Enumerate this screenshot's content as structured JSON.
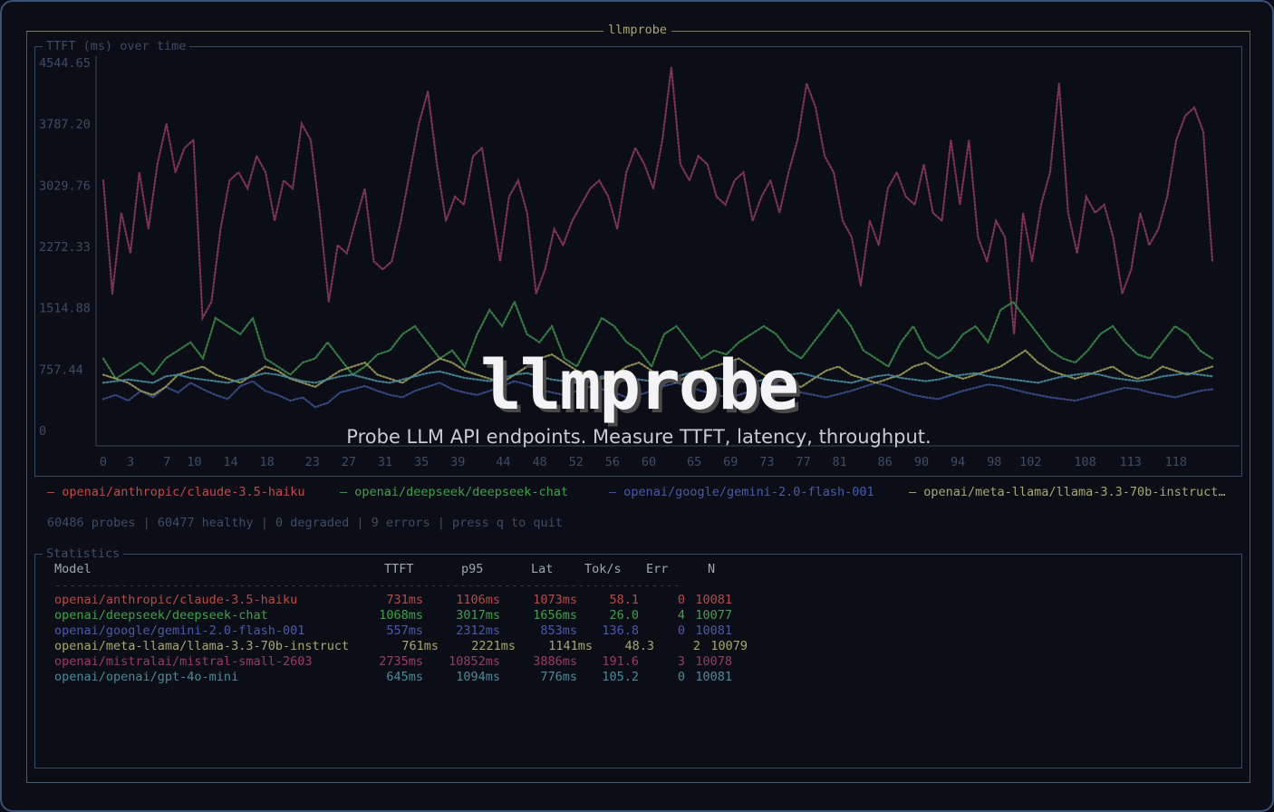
{
  "app": {
    "window_title": "llmprobe",
    "overlay_title": "llmprobe",
    "overlay_subtitle": "Probe LLM API endpoints. Measure TTFT, latency, throughput."
  },
  "chart_panel": {
    "title": "TTFT (ms) over time"
  },
  "chart_data": {
    "type": "line",
    "title": "TTFT (ms) over time",
    "xlabel": "",
    "ylabel": "",
    "ylim": [
      0,
      4544.65
    ],
    "xlim": [
      0,
      122
    ],
    "y_ticks": [
      "4544.65",
      "3787.20",
      "3029.76",
      "2272.33",
      "1514.88",
      "757.44",
      "0"
    ],
    "x_ticks": [
      "0",
      "3",
      "7",
      "10",
      "14",
      "18",
      "23",
      "27",
      "31",
      "35",
      "39",
      "44",
      "48",
      "52",
      "56",
      "60",
      "65",
      "69",
      "73",
      "77",
      "81",
      "86",
      "90",
      "94",
      "98",
      "102",
      "108",
      "113",
      "118"
    ],
    "grid": false,
    "legend_position": "bottom",
    "series": [
      {
        "name": "openai/anthropic/claude-3.5-haiku",
        "color": "#8a3a5a",
        "values": [
          3100,
          1700,
          2700,
          2200,
          3200,
          2500,
          3300,
          3800,
          3200,
          3500,
          3600,
          1400,
          1600,
          2500,
          3100,
          3200,
          3000,
          3400,
          3200,
          2600,
          3100,
          3000,
          3800,
          3600,
          2700,
          1600,
          2300,
          2200,
          2600,
          3000,
          2100,
          2000,
          2100,
          2600,
          3200,
          3800,
          4200,
          3300,
          2600,
          2900,
          2800,
          3400,
          3500,
          2800,
          2100,
          2900,
          3100,
          2700,
          1700,
          2000,
          2500,
          2300,
          2600,
          2800,
          3000,
          3100,
          2900,
          2500,
          3200,
          3500,
          3300,
          3000,
          3600,
          4500,
          3300,
          3100,
          3400,
          3300,
          2900,
          2800,
          3100,
          3200,
          2600,
          2900,
          3100,
          2700,
          3200,
          3600,
          4300,
          4000,
          3400,
          3200,
          2600,
          2400,
          1800,
          2600,
          2300,
          3000,
          3200,
          2900,
          2800,
          3300,
          2700,
          2600,
          3600,
          2800,
          3600,
          2400,
          2100,
          2600,
          2400,
          1200,
          2700,
          2100,
          2800,
          3200,
          4300,
          2700,
          2200,
          2900,
          2700,
          2800,
          2400,
          1700,
          2000,
          2700,
          2300,
          2500,
          2900,
          3600,
          3900,
          4000,
          3700,
          2100
        ]
      },
      {
        "name": "openai/deepseek/deepseek-chat",
        "color": "#3a8a4c",
        "values": [
          900,
          650,
          750,
          850,
          700,
          900,
          1000,
          1100,
          900,
          1400,
          1300,
          1200,
          1400,
          900,
          800,
          700,
          850,
          900,
          1100,
          900,
          700,
          800,
          950,
          1000,
          1200,
          1300,
          1100,
          900,
          1000,
          800,
          1200,
          1500,
          1300,
          1600,
          1200,
          1100,
          1300,
          900,
          800,
          1100,
          1400,
          1300,
          1100,
          1000,
          800,
          1200,
          1300,
          1100,
          900,
          1000,
          950,
          1100,
          1200,
          1300,
          1200,
          1000,
          900,
          1100,
          1300,
          1500,
          1300,
          1000,
          900,
          800,
          1100,
          1300,
          1000,
          900,
          1000,
          1200,
          1300,
          1100,
          1500,
          1600,
          1400,
          1200,
          1000,
          900,
          850,
          1000,
          1200,
          1300,
          1100,
          950,
          900,
          1100,
          1300,
          1200,
          1000,
          900
        ]
      },
      {
        "name": "openai/google/gemini-2.0-flash-001",
        "color": "#3a4e8a",
        "values": [
          400,
          450,
          380,
          500,
          420,
          550,
          480,
          600,
          520,
          450,
          400,
          560,
          620,
          500,
          450,
          380,
          420,
          300,
          350,
          480,
          520,
          560,
          500,
          450,
          420,
          500,
          550,
          600,
          520,
          480,
          450,
          500,
          560,
          620,
          580,
          520,
          480,
          450,
          500,
          550,
          520,
          480,
          420,
          450,
          500,
          560,
          600,
          550,
          500,
          460,
          420,
          450,
          500,
          540,
          580,
          520,
          480,
          450,
          420,
          460,
          500,
          550,
          600,
          560,
          500,
          450,
          420,
          400,
          450,
          500,
          540,
          580,
          560,
          520,
          480,
          450,
          420,
          400,
          380,
          420,
          460,
          500,
          540,
          520,
          480,
          450,
          420,
          460,
          500,
          520
        ]
      },
      {
        "name": "openai/meta-llama/llama-3.3-70b-instruct",
        "color": "#9a9a5a",
        "values": [
          700,
          650,
          600,
          500,
          450,
          550,
          700,
          750,
          800,
          700,
          650,
          600,
          700,
          800,
          750,
          650,
          600,
          550,
          650,
          750,
          800,
          850,
          700,
          650,
          600,
          700,
          800,
          900,
          850,
          750,
          700,
          650,
          600,
          700,
          800,
          900,
          950,
          850,
          750,
          700,
          650,
          700,
          800,
          850,
          750,
          650,
          600,
          700,
          750,
          800,
          850,
          900,
          800,
          700,
          650,
          600,
          550,
          650,
          750,
          800,
          700,
          650,
          600,
          650,
          700,
          800,
          850,
          750,
          700,
          650,
          700,
          750,
          800,
          900,
          1000,
          850,
          750,
          700,
          650,
          700,
          750,
          800,
          700,
          650,
          700,
          800,
          750,
          700,
          750,
          800
        ]
      },
      {
        "name": "openai/mistralai/mistral-small-2603",
        "color": "#8a3a6a",
        "values": []
      },
      {
        "name": "openai/openai/gpt-4o-mini",
        "color": "#4a8a9a",
        "values": [
          600,
          620,
          640,
          620,
          600,
          680,
          700,
          660,
          640,
          620,
          600,
          640,
          680,
          720,
          700,
          660,
          620,
          600,
          640,
          680,
          700,
          660,
          620,
          600,
          640,
          680,
          720,
          740,
          700,
          660,
          640,
          620,
          660,
          700,
          720,
          680,
          640,
          620,
          600,
          640,
          680,
          700,
          660,
          640,
          620,
          640,
          680,
          720,
          700,
          660,
          640,
          620,
          600,
          640,
          680,
          700,
          720,
          680,
          640,
          620,
          600,
          640,
          680,
          700,
          660,
          640,
          620,
          640,
          680,
          700,
          720,
          680,
          660,
          640,
          620,
          600,
          640,
          680,
          700,
          720,
          700,
          660,
          640,
          620,
          640,
          680,
          700,
          720,
          700,
          680
        ]
      }
    ]
  },
  "legend": [
    {
      "label": "openai/anthropic/claude-3.5-haiku",
      "color": "#c24a4a"
    },
    {
      "label": "openai/deepseek/deepseek-chat",
      "color": "#3fa14c"
    },
    {
      "label": "openai/google/gemini-2.0-flash-001",
      "color": "#4a5aa8"
    },
    {
      "label": "openai/meta-llama/llama-3.3-70b-instruct…",
      "color": "#a8a870"
    }
  ],
  "status": {
    "text": "60486 probes | 60477 healthy | 0 degraded | 9 errors | press q to quit"
  },
  "stats_panel": {
    "title": "Statistics",
    "headers": {
      "model": "Model",
      "ttft": "TTFT",
      "p95": "p95",
      "lat": "Lat",
      "toks": "Tok/s",
      "err": "Err",
      "n": "N"
    },
    "separator": "-------------------------------------------------------------------------------------",
    "rows": [
      {
        "model": "openai/anthropic/claude-3.5-haiku",
        "ttft": "731ms",
        "p95": "1106ms",
        "lat": "1073ms",
        "toks": "58.1",
        "err": "0",
        "n": "10081",
        "color": "#b84a4a"
      },
      {
        "model": "openai/deepseek/deepseek-chat",
        "ttft": "1068ms",
        "p95": "3017ms",
        "lat": "1656ms",
        "toks": "26.0",
        "err": "4",
        "n": "10077",
        "color": "#3fa14c"
      },
      {
        "model": "openai/google/gemini-2.0-flash-001",
        "ttft": "557ms",
        "p95": "2312ms",
        "lat": "853ms",
        "toks": "136.8",
        "err": "0",
        "n": "10081",
        "color": "#4a5aa8"
      },
      {
        "model": "openai/meta-llama/llama-3.3-70b-instruct",
        "ttft": "761ms",
        "p95": "2221ms",
        "lat": "1141ms",
        "toks": "48.3",
        "err": "2",
        "n": "10079",
        "color": "#a8a870"
      },
      {
        "model": "openai/mistralai/mistral-small-2603",
        "ttft": "2735ms",
        "p95": "10852ms",
        "lat": "3886ms",
        "toks": "191.6",
        "err": "3",
        "n": "10078",
        "color": "#9a3a6a"
      },
      {
        "model": "openai/openai/gpt-4o-mini",
        "ttft": "645ms",
        "p95": "1094ms",
        "lat": "776ms",
        "toks": "105.2",
        "err": "0",
        "n": "10081",
        "color": "#4a8a9a"
      }
    ]
  }
}
